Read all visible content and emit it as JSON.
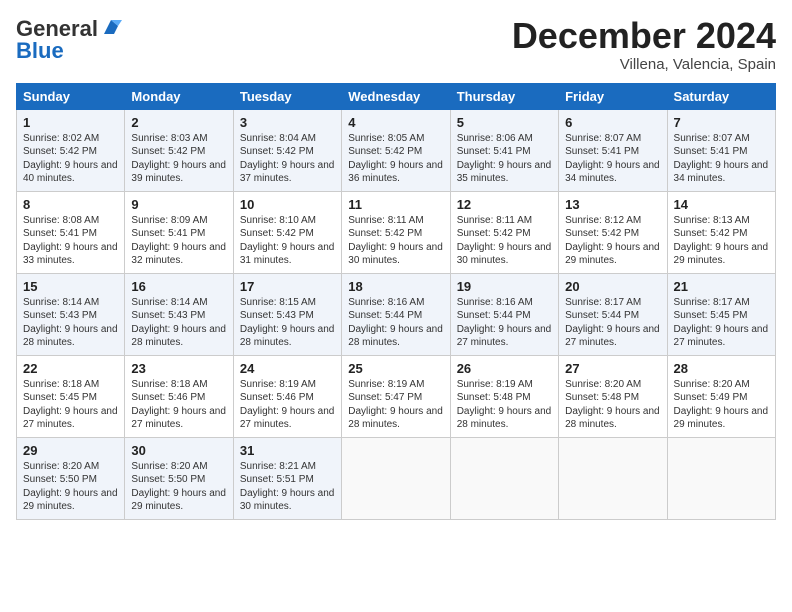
{
  "header": {
    "logo_line1": "General",
    "logo_line2": "Blue",
    "month": "December 2024",
    "location": "Villena, Valencia, Spain"
  },
  "weekdays": [
    "Sunday",
    "Monday",
    "Tuesday",
    "Wednesday",
    "Thursday",
    "Friday",
    "Saturday"
  ],
  "weeks": [
    [
      {
        "day": "1",
        "sunrise": "8:02 AM",
        "sunset": "5:42 PM",
        "daylight": "9 hours and 40 minutes."
      },
      {
        "day": "2",
        "sunrise": "8:03 AM",
        "sunset": "5:42 PM",
        "daylight": "9 hours and 39 minutes."
      },
      {
        "day": "3",
        "sunrise": "8:04 AM",
        "sunset": "5:42 PM",
        "daylight": "9 hours and 37 minutes."
      },
      {
        "day": "4",
        "sunrise": "8:05 AM",
        "sunset": "5:42 PM",
        "daylight": "9 hours and 36 minutes."
      },
      {
        "day": "5",
        "sunrise": "8:06 AM",
        "sunset": "5:41 PM",
        "daylight": "9 hours and 35 minutes."
      },
      {
        "day": "6",
        "sunrise": "8:07 AM",
        "sunset": "5:41 PM",
        "daylight": "9 hours and 34 minutes."
      },
      {
        "day": "7",
        "sunrise": "8:07 AM",
        "sunset": "5:41 PM",
        "daylight": "9 hours and 34 minutes."
      }
    ],
    [
      {
        "day": "8",
        "sunrise": "8:08 AM",
        "sunset": "5:41 PM",
        "daylight": "9 hours and 33 minutes."
      },
      {
        "day": "9",
        "sunrise": "8:09 AM",
        "sunset": "5:41 PM",
        "daylight": "9 hours and 32 minutes."
      },
      {
        "day": "10",
        "sunrise": "8:10 AM",
        "sunset": "5:42 PM",
        "daylight": "9 hours and 31 minutes."
      },
      {
        "day": "11",
        "sunrise": "8:11 AM",
        "sunset": "5:42 PM",
        "daylight": "9 hours and 30 minutes."
      },
      {
        "day": "12",
        "sunrise": "8:11 AM",
        "sunset": "5:42 PM",
        "daylight": "9 hours and 30 minutes."
      },
      {
        "day": "13",
        "sunrise": "8:12 AM",
        "sunset": "5:42 PM",
        "daylight": "9 hours and 29 minutes."
      },
      {
        "day": "14",
        "sunrise": "8:13 AM",
        "sunset": "5:42 PM",
        "daylight": "9 hours and 29 minutes."
      }
    ],
    [
      {
        "day": "15",
        "sunrise": "8:14 AM",
        "sunset": "5:43 PM",
        "daylight": "9 hours and 28 minutes."
      },
      {
        "day": "16",
        "sunrise": "8:14 AM",
        "sunset": "5:43 PM",
        "daylight": "9 hours and 28 minutes."
      },
      {
        "day": "17",
        "sunrise": "8:15 AM",
        "sunset": "5:43 PM",
        "daylight": "9 hours and 28 minutes."
      },
      {
        "day": "18",
        "sunrise": "8:16 AM",
        "sunset": "5:44 PM",
        "daylight": "9 hours and 28 minutes."
      },
      {
        "day": "19",
        "sunrise": "8:16 AM",
        "sunset": "5:44 PM",
        "daylight": "9 hours and 27 minutes."
      },
      {
        "day": "20",
        "sunrise": "8:17 AM",
        "sunset": "5:44 PM",
        "daylight": "9 hours and 27 minutes."
      },
      {
        "day": "21",
        "sunrise": "8:17 AM",
        "sunset": "5:45 PM",
        "daylight": "9 hours and 27 minutes."
      }
    ],
    [
      {
        "day": "22",
        "sunrise": "8:18 AM",
        "sunset": "5:45 PM",
        "daylight": "9 hours and 27 minutes."
      },
      {
        "day": "23",
        "sunrise": "8:18 AM",
        "sunset": "5:46 PM",
        "daylight": "9 hours and 27 minutes."
      },
      {
        "day": "24",
        "sunrise": "8:19 AM",
        "sunset": "5:46 PM",
        "daylight": "9 hours and 27 minutes."
      },
      {
        "day": "25",
        "sunrise": "8:19 AM",
        "sunset": "5:47 PM",
        "daylight": "9 hours and 28 minutes."
      },
      {
        "day": "26",
        "sunrise": "8:19 AM",
        "sunset": "5:48 PM",
        "daylight": "9 hours and 28 minutes."
      },
      {
        "day": "27",
        "sunrise": "8:20 AM",
        "sunset": "5:48 PM",
        "daylight": "9 hours and 28 minutes."
      },
      {
        "day": "28",
        "sunrise": "8:20 AM",
        "sunset": "5:49 PM",
        "daylight": "9 hours and 29 minutes."
      }
    ],
    [
      {
        "day": "29",
        "sunrise": "8:20 AM",
        "sunset": "5:50 PM",
        "daylight": "9 hours and 29 minutes."
      },
      {
        "day": "30",
        "sunrise": "8:20 AM",
        "sunset": "5:50 PM",
        "daylight": "9 hours and 29 minutes."
      },
      {
        "day": "31",
        "sunrise": "8:21 AM",
        "sunset": "5:51 PM",
        "daylight": "9 hours and 30 minutes."
      },
      null,
      null,
      null,
      null
    ]
  ]
}
